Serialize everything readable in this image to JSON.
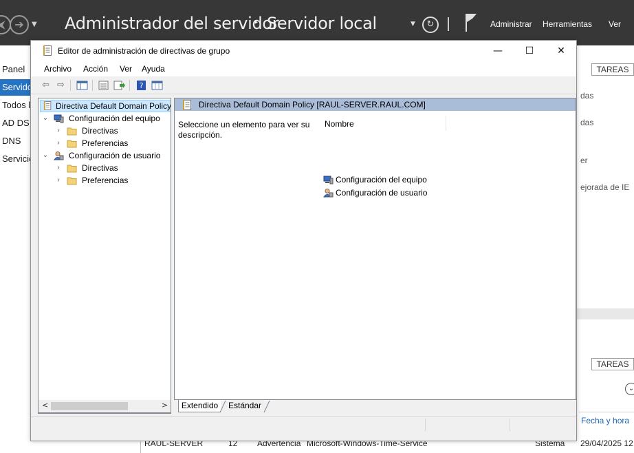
{
  "server_manager": {
    "title": "Administrador del servidor",
    "breadcrumb_separator": "‣",
    "breadcrumb": "Servidor local",
    "menu": [
      "Administrar",
      "Herramientas",
      "Ver"
    ],
    "icons": [
      "back-icon",
      "forward-icon",
      "dropdown-icon",
      "refresh-icon",
      "notifications-flag-icon"
    ],
    "sidebar": [
      "Panel",
      "Servidor",
      "Todos l",
      "AD DS",
      "DNS",
      "Servicio"
    ],
    "right_fragments": [
      "das",
      "das",
      "er",
      "ejorada de IE"
    ],
    "tareas": "TAREAS",
    "fecha_header": "Fecha y hora",
    "event_row": {
      "server": "RAUL-SERVER",
      "id": "12",
      "level": "Advertencia",
      "source": "Microsoft-Windows-Time-Service",
      "log": "Sistema",
      "date": "29/04/2025 12"
    },
    "accent_color": "#2673c3",
    "header_color": "#373737"
  },
  "gp_editor": {
    "window_title": "Editor de administración de directivas de grupo",
    "controls": {
      "minimize": "—",
      "maximize": "☐",
      "close": "✕"
    },
    "menu": [
      "Archivo",
      "Acción",
      "Ver",
      "Ayuda"
    ],
    "toolbar_icons": [
      "back-arrow-icon",
      "forward-arrow-icon",
      "show-hide-tree-icon",
      "properties-icon",
      "export-list-icon",
      "help-icon",
      "view-icon"
    ],
    "tree": [
      {
        "label": "Directiva Default Domain Policy",
        "icon": "policy-document-icon",
        "expander": "",
        "selected": true
      },
      {
        "label": "Configuración del equipo",
        "icon": "computer-icon",
        "expander": "⌄"
      },
      {
        "label": "Directivas",
        "icon": "folder-icon",
        "expander": "›"
      },
      {
        "label": "Preferencias",
        "icon": "folder-icon",
        "expander": "›"
      },
      {
        "label": "Configuración de usuario",
        "icon": "user-icon",
        "expander": "⌄"
      },
      {
        "label": "Directivas",
        "icon": "folder-icon",
        "expander": "›"
      },
      {
        "label": "Preferencias",
        "icon": "folder-icon",
        "expander": "›"
      }
    ],
    "scroll_left": "<",
    "scroll_right": ">",
    "detail": {
      "header": "Directiva Default Domain Policy [RAUL-SERVER.RAUL.COM]",
      "description": "Seleccione un elemento para ver su descripción.",
      "column": "Nombre",
      "items": [
        {
          "label": "Configuración del equipo",
          "icon": "computer-icon"
        },
        {
          "label": "Configuración de usuario",
          "icon": "user-icon"
        }
      ]
    },
    "tabs": [
      "Extendido",
      "Estándar"
    ],
    "active_tab": "Extendido"
  }
}
